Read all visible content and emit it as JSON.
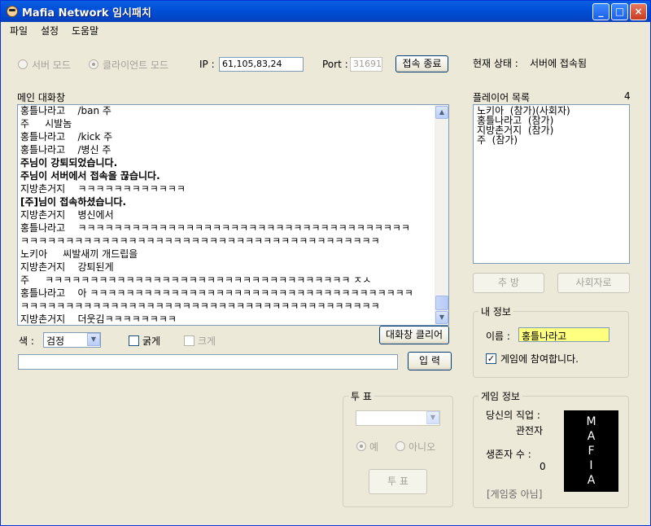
{
  "window": {
    "title": "Mafia Network 임시패치",
    "minimize": "_",
    "maximize": "□",
    "close": "×"
  },
  "menu": [
    "파일",
    "설정",
    "도움말"
  ],
  "connection": {
    "server_mode": "서버 모드",
    "client_mode": "클라이언트 모드",
    "ip_label": "IP :",
    "ip_value": "61,105,83,24",
    "port_label": "Port :",
    "port_value": "31691",
    "disconnect_button": "접속 종료",
    "status_label": "현재 상태 :",
    "status_value": "서버에 접속됨"
  },
  "chat": {
    "title": "메인 대화창",
    "lines": [
      {
        "text": "홍틀나라고    /ban 주",
        "bold": false
      },
      {
        "text": "주     시발놈",
        "bold": false
      },
      {
        "text": "홍틀나라고    /kick 주",
        "bold": false
      },
      {
        "text": "홍틀나라고    /병신 주",
        "bold": false
      },
      {
        "text": "주님이 강퇴되었습니다.",
        "bold": true
      },
      {
        "text": "주님이 서버에서 접속을 끊습니다.",
        "bold": true
      },
      {
        "text": "지방촌거지    ㅋㅋㅋㅋㅋㅋㅋㅋㅋㅋㅋㅋ",
        "bold": false
      },
      {
        "text": "[주]님이 접속하셨습니다.",
        "bold": true
      },
      {
        "text": "지방촌거지    병신에서",
        "bold": false
      },
      {
        "text": "홍틀나라고    ㅋㅋㅋㅋㅋㅋㅋㅋㅋㅋㅋㅋㅋㅋㅋㅋㅋㅋㅋㅋㅋㅋㅋㅋㅋㅋㅋㅋㅋㅋㅋㅋㅋㅋㅋㅋㅋ",
        "bold": false
      },
      {
        "text": "ㅋㅋㅋㅋㅋㅋㅋㅋㅋㅋㅋㅋㅋㅋㅋㅋㅋㅋㅋㅋㅋㅋㅋㅋㅋㅋㅋㅋㅋㅋㅋㅋㅋㅋㅋㅋㅋㅋㅋㅋ",
        "bold": false
      },
      {
        "text": "노키아     씨발새끼 개드립을",
        "bold": false
      },
      {
        "text": "지방촌거지    강퇴된게",
        "bold": false
      },
      {
        "text": "주     ㅋㅋㅋㅋㅋㅋㅋㅋㅋㅋㅋㅋㅋㅋㅋㅋㅋㅋㅋㅋㅋㅋㅋㅋㅋㅋㅋㅋㅋㅋㅋㅋㅋㅋ ㅈㅅ",
        "bold": false
      },
      {
        "text": "홍틀나라고    아 ㅋㅋㅋㅋㅋㅋㅋㅋㅋㅋㅋㅋㅋㅋㅋㅋㅋㅋㅋㅋㅋㅋㅋㅋㅋㅋㅋㅋㅋㅋㅋㅋㅋㅋㅋㅋ",
        "bold": false
      },
      {
        "text": "ㅋㅋㅋㅋㅋㅋㅋㅋㅋㅋㅋㅋㅋㅋㅋㅋㅋㅋㅋㅋㅋㅋㅋㅋㅋㅋㅋㅋㅋㅋㅋㅋㅋㅋㅋㅋㅋㅋㅋㅋ",
        "bold": false
      },
      {
        "text": "지방촌거지    더웃김ㅋㅋㅋㅋㅋㅋㅋㅋ",
        "bold": false
      }
    ],
    "color_label": "색 :",
    "color_value": "검정",
    "bold_label": "굵게",
    "large_label": "크게",
    "clear_button": "대화창 클리어",
    "input_value": "",
    "send_button": "입 력"
  },
  "players": {
    "title": "플레이어 목록",
    "count": "4",
    "items": [
      "노키아  (참가)(사회자)",
      "홍틀나라고  (참가)",
      "지방촌거지  (참가)",
      "주  (참가)"
    ],
    "kick_button": "추 방",
    "host_button": "사회자로"
  },
  "my_info": {
    "title": "내 정보",
    "name_label": "이름 :",
    "name_value": "홍틀나라고",
    "join_label": "게임에 참여합니다."
  },
  "vote": {
    "title": "투 표",
    "select_value": "",
    "yes_label": "예",
    "no_label": "아니오",
    "vote_button": "투 표"
  },
  "game_info": {
    "title": "게임 정보",
    "job_label": "당신의 직업 :",
    "job_value": "관전자",
    "survivors_label": "생존자 수 :",
    "survivors_value": "0",
    "status_text": "[게임중 아님]",
    "logo_letters": [
      "M",
      "A",
      "F",
      "I",
      "A"
    ]
  },
  "colors": {
    "title_bar": "#0150d8",
    "name_highlight": "#ffff80",
    "window_bg": "#ece9d8"
  }
}
